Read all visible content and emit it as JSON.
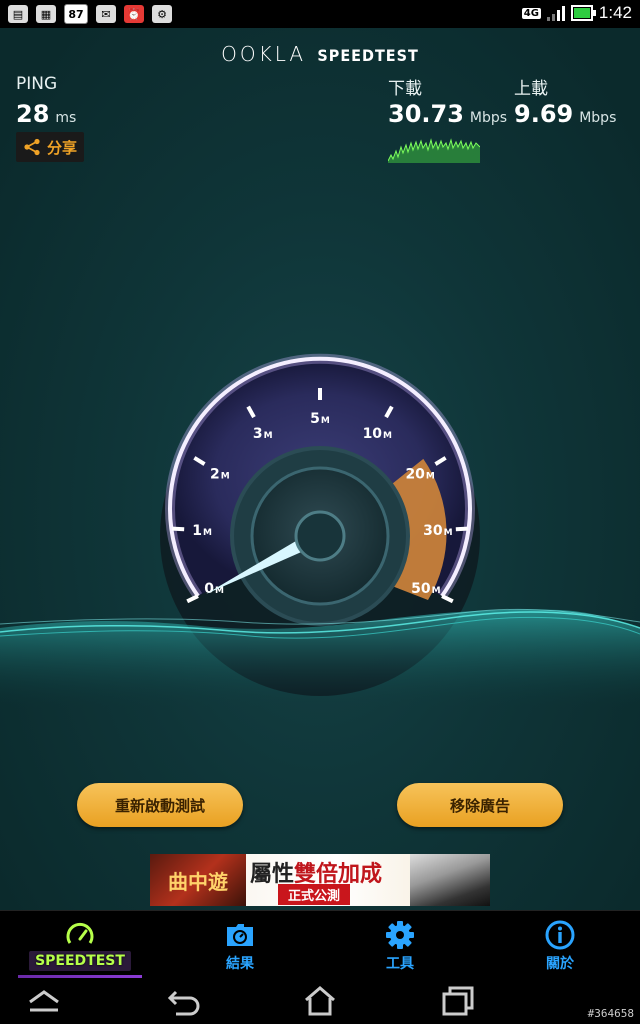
{
  "status_bar": {
    "notification_badge": "87",
    "network": "4G",
    "time": "1:42"
  },
  "brand": {
    "ookla": "OOKLA",
    "speedtest": "SPEEDTEST"
  },
  "ping": {
    "label": "PING",
    "value": "28",
    "unit": "ms"
  },
  "download": {
    "label": "下載",
    "value": "30.73",
    "unit": "Mbps"
  },
  "upload": {
    "label": "上載",
    "value": "9.69",
    "unit": "Mbps"
  },
  "share_label": "分享",
  "gauge": {
    "ticks": [
      "0",
      "1",
      "2",
      "3",
      "5",
      "10",
      "20",
      "30",
      "50"
    ],
    "tick_unit": "M",
    "needle_value": 0.5,
    "accent": "#c8813a",
    "arc_glow": "#c9b4ff"
  },
  "buttons": {
    "restart": "重新啟動測試",
    "remove_ads": "移除廣告"
  },
  "ad": {
    "logo_text": "曲中遊",
    "title_a": "屬性",
    "title_b": "雙倍加成",
    "subtitle": "正式公測"
  },
  "tabs": [
    {
      "label": "SPEEDTEST",
      "icon": "speedometer-icon",
      "active": true
    },
    {
      "label": "結果",
      "icon": "results-folder-icon",
      "active": false
    },
    {
      "label": "工具",
      "icon": "gear-icon",
      "active": false
    },
    {
      "label": "關於",
      "icon": "info-icon",
      "active": false
    }
  ],
  "watermark": "#364658",
  "colors": {
    "accent_orange": "#f0a326",
    "tab_blue": "#2aa4ff",
    "active_green": "#b6ff4a",
    "button_gold": "#e9a122"
  }
}
